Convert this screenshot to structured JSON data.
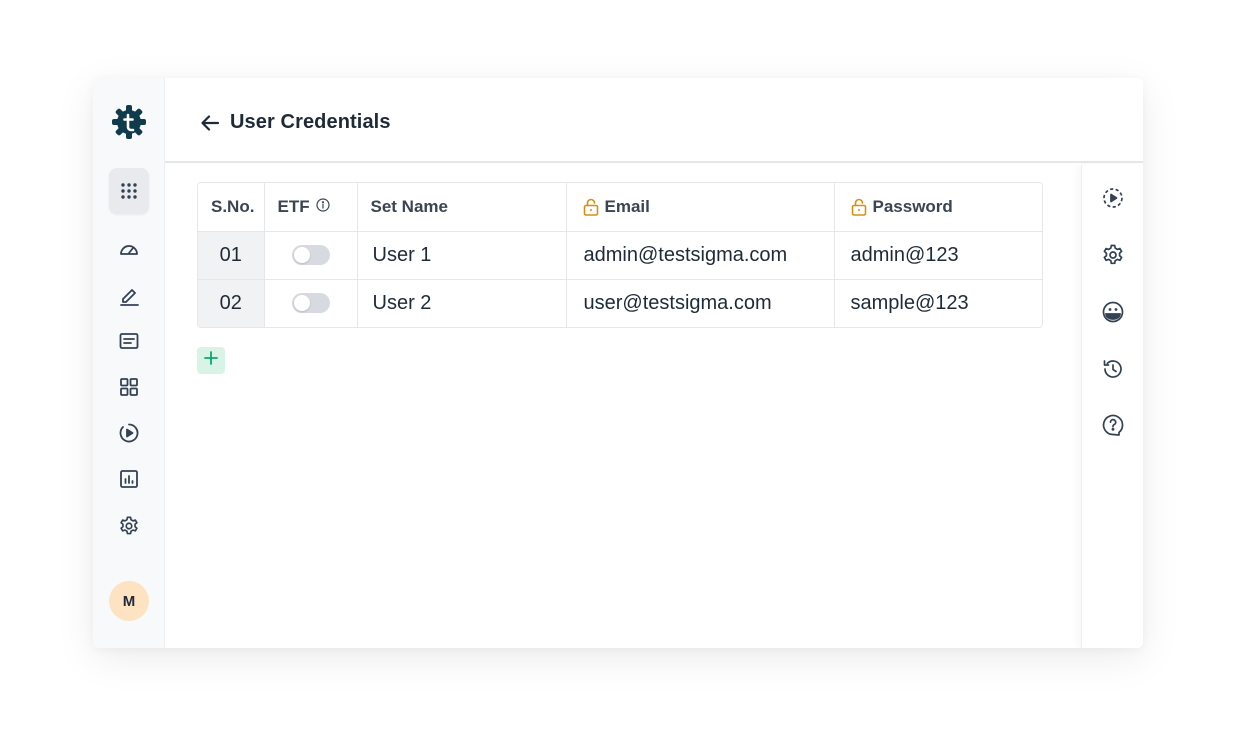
{
  "app": {
    "logo_icon": "testsigma-gear-logo-icon",
    "brand_color": "#0f3b4c",
    "accent_color": "#10b981"
  },
  "leftnav": {
    "items": [
      {
        "name": "apps-grid",
        "icon": "apps-grid-icon"
      },
      {
        "name": "dashboard",
        "icon": "speedometer-icon"
      },
      {
        "name": "create-tests",
        "icon": "pencil-icon"
      },
      {
        "name": "test-cases",
        "icon": "document-list-icon"
      },
      {
        "name": "modules",
        "icon": "grid-four-icon"
      },
      {
        "name": "run-tests",
        "icon": "play-circle-icon"
      },
      {
        "name": "reports",
        "icon": "bar-chart-icon"
      },
      {
        "name": "settings",
        "icon": "gear-icon"
      }
    ],
    "avatar_initial": "M"
  },
  "header": {
    "title": "User Credentials",
    "back_icon": "arrow-left-icon"
  },
  "table": {
    "columns": [
      {
        "label": "S.No."
      },
      {
        "label": "ETF",
        "icon": "info-icon"
      },
      {
        "label": "Set Name"
      },
      {
        "label": "Email",
        "icon": "lock-icon"
      },
      {
        "label": "Password",
        "icon": "lock-icon"
      }
    ],
    "rows": [
      {
        "sno": "01",
        "etf_enabled": false,
        "set_name": "User 1",
        "email": "admin@testsigma.com",
        "password": "admin@123"
      },
      {
        "sno": "02",
        "etf_enabled": false,
        "set_name": "User 2",
        "email": "user@testsigma.com",
        "password": "sample@123"
      }
    ],
    "add_icon": "plus-icon"
  },
  "rightrail": {
    "items": [
      {
        "name": "run",
        "icon": "play-circle-dashed-icon"
      },
      {
        "name": "settings",
        "icon": "gear-icon"
      },
      {
        "name": "ai-assistant",
        "icon": "bot-face-icon"
      },
      {
        "name": "history",
        "icon": "history-icon"
      },
      {
        "name": "help",
        "icon": "help-circle-icon"
      }
    ]
  }
}
